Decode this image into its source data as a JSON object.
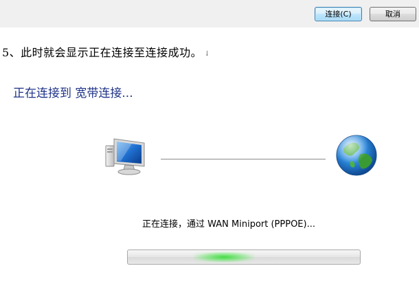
{
  "dialog_buttons": {
    "connect_label": "连接(C)",
    "cancel_label": "取消"
  },
  "document": {
    "step_text": "5、此时就会显示正在连接至连接成功。",
    "pilcrow": "↓"
  },
  "dialog": {
    "title": "正在连接到 宽带连接...",
    "status": "正在连接，通过 WAN Miniport (PPPOE)...",
    "left_icon": "computer-icon",
    "right_icon": "globe-icon",
    "progress_style": "marquee-indeterminate",
    "accent_color": "#1e3287",
    "progress_color": "#3cdc3c"
  }
}
